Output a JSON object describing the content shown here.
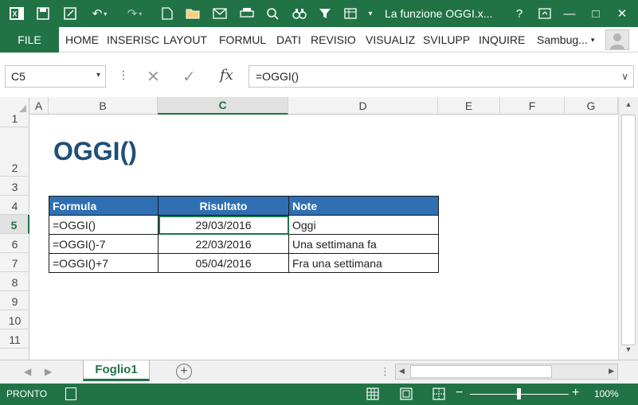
{
  "window": {
    "title": "La funzione OGGI.x...",
    "help": "?",
    "minimize": "—",
    "maximize": "□",
    "close": "✕"
  },
  "ribbon": {
    "file": "FILE",
    "tabs": [
      "HOME",
      "INSERISC",
      "LAYOUT",
      "FORMUL",
      "DATI",
      "REVISIO",
      "VISUALIZ",
      "SVILUPP",
      "INQUIRE"
    ],
    "user": "Sambug..."
  },
  "formula_bar": {
    "name_box": "C5",
    "formula": "=OGGI()"
  },
  "grid": {
    "columns": [
      "A",
      "B",
      "C",
      "D",
      "E",
      "F",
      "G"
    ],
    "rows": [
      "1",
      "2",
      "3",
      "4",
      "5",
      "6",
      "7",
      "8",
      "9",
      "10",
      "11"
    ],
    "selected_column": "C",
    "selected_row": "5"
  },
  "sheet": {
    "title": "OGGI()",
    "table": {
      "headers": [
        "Formula",
        "Risultato",
        "Note"
      ],
      "rows": [
        [
          "=OGGI()",
          "29/03/2016",
          "Oggi"
        ],
        [
          "=OGGI()-7",
          "22/03/2016",
          "Una settimana fa"
        ],
        [
          "=OGGI()+7",
          "05/04/2016",
          "Fra una settimana"
        ]
      ]
    }
  },
  "sheet_tabs": {
    "active": "Foglio1"
  },
  "status_bar": {
    "status": "PRONTO",
    "zoom": "100%"
  },
  "colors": {
    "excel_green": "#217346",
    "table_header": "#2f6fb2",
    "title_text": "#1f4e79"
  }
}
